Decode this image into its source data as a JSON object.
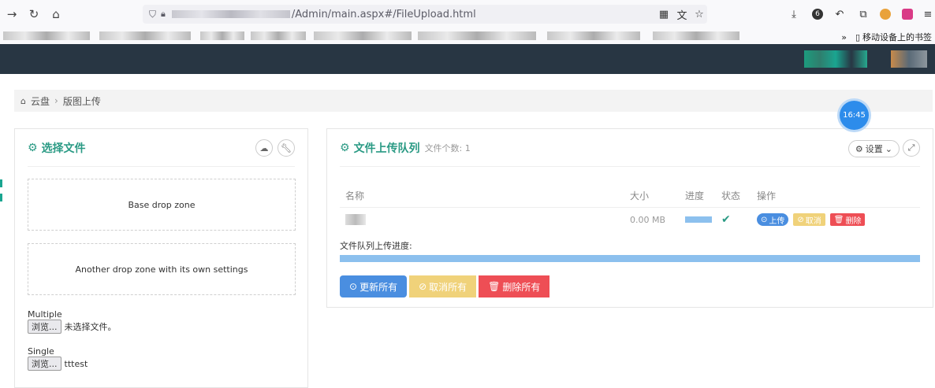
{
  "browser": {
    "url_path": "/Admin/main.aspx#/FileUpload.html",
    "mobile_bookmarks": "移动设备上的书签",
    "account_badge": "6"
  },
  "breadcrumb": {
    "home": "云盘",
    "current": "版图上传"
  },
  "clock": {
    "time": "16:45"
  },
  "select_panel": {
    "title": "选择文件",
    "dropzone_base": "Base drop zone",
    "dropzone_other": "Another drop zone with its own settings",
    "multiple_label": "Multiple",
    "multiple_browse": "浏览...",
    "multiple_status": "未选择文件。",
    "single_label": "Single",
    "single_browse": "浏览...",
    "single_status": "tttest"
  },
  "queue_panel": {
    "title": "文件上传队列",
    "subtitle": "文件个数: 1",
    "settings_label": "设置",
    "columns": [
      "名称",
      "大小",
      "进度",
      "状态",
      "操作"
    ],
    "rows": [
      {
        "size": "0.00 MB",
        "progress": 1.0,
        "upload": "上传",
        "cancel": "取消",
        "delete": "删除"
      }
    ],
    "queue_progress_label": "文件队列上传进度:",
    "queue_progress": 1.0,
    "update_all": "更新所有",
    "cancel_all": "取消所有",
    "delete_all": "删除所有"
  },
  "colors": {
    "accent": "#2a9a84",
    "header_bg": "#283643",
    "progress": "#8cc0ee",
    "blue": "#4a8ee0",
    "yellow": "#f0d27a",
    "red": "#ee4e55"
  }
}
